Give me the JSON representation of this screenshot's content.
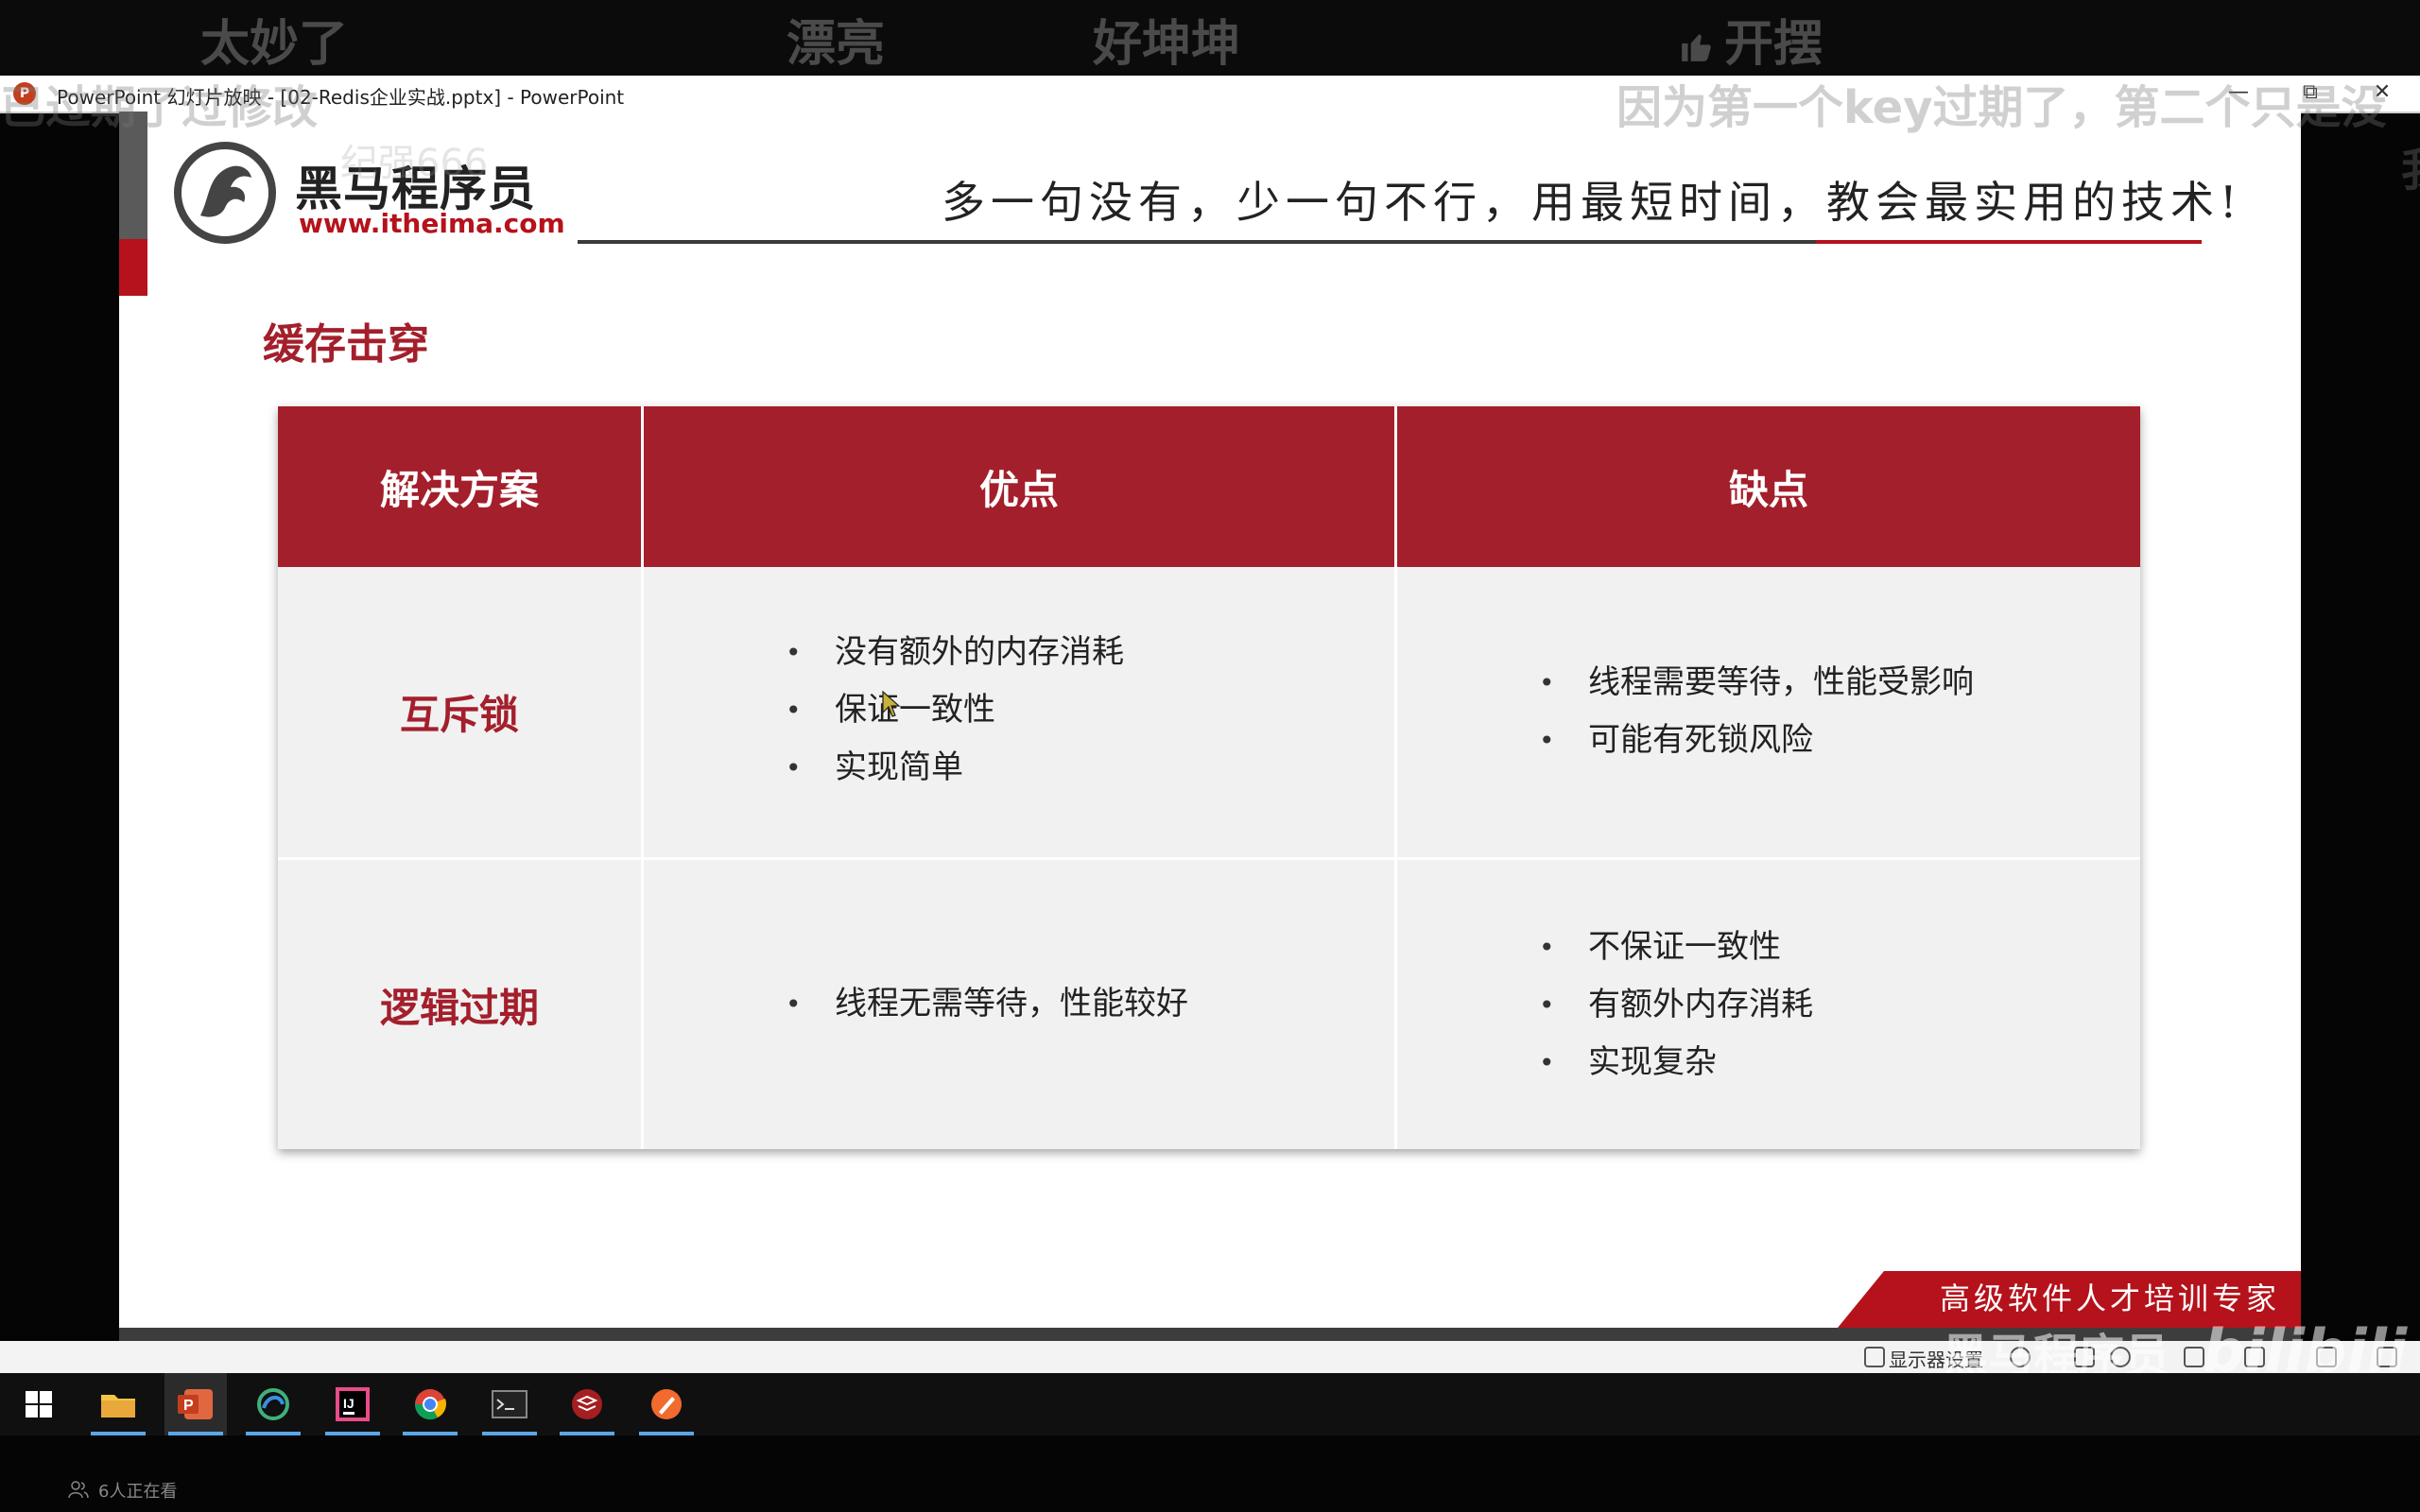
{
  "danmaku_top": [
    "太妙了",
    "漂亮",
    "好坤坤",
    "开摆"
  ],
  "overlay_danmaku": {
    "left": "已过期了过修改",
    "right": "因为第一个key过期了，第二个只是没",
    "far_right": "我"
  },
  "window": {
    "title": "PowerPoint 幻灯片放映 - [02-Redis企业实战.pptx] - PowerPoint",
    "icon": "powerpoint-icon",
    "controls": [
      "—",
      "⧉",
      "✕"
    ]
  },
  "slide": {
    "logo_name": "黑马程序员",
    "logo_url": "www.itheima.com",
    "ghost_watermark": "纪强666",
    "slogan": "多一句没有，少一句不行，用最短时间，教会最实用的技术!",
    "title": "缓存击穿",
    "table": {
      "headers": [
        "解决方案",
        "优点",
        "缺点"
      ],
      "rows": [
        {
          "solution": "互斥锁",
          "pros": [
            "没有额外的内存消耗",
            "保证一致性",
            "实现简单"
          ],
          "cons": [
            "线程需要等待，性能受影响",
            "可能有死锁风险"
          ]
        },
        {
          "solution": "逻辑过期",
          "pros": [
            "线程无需等待，性能较好"
          ],
          "cons": [
            "不保证一致性",
            "有额外内存消耗",
            "实现复杂"
          ]
        }
      ]
    },
    "ribbon": "高级软件人才培训专家",
    "accent_color": "#a31f2b"
  },
  "status_bar": {
    "display_settings": "显示器设置"
  },
  "taskbar": {
    "items": [
      "windows-start-icon",
      "file-explorer-icon",
      "powerpoint-icon",
      "browser-icon",
      "intellij-icon",
      "chrome-icon",
      "terminal-icon",
      "redis-icon",
      "app-icon"
    ]
  },
  "watermark": {
    "bilibili_text": "黑马程序员",
    "bilibili_logo": "bilibili"
  },
  "viewers": "6人正在看"
}
